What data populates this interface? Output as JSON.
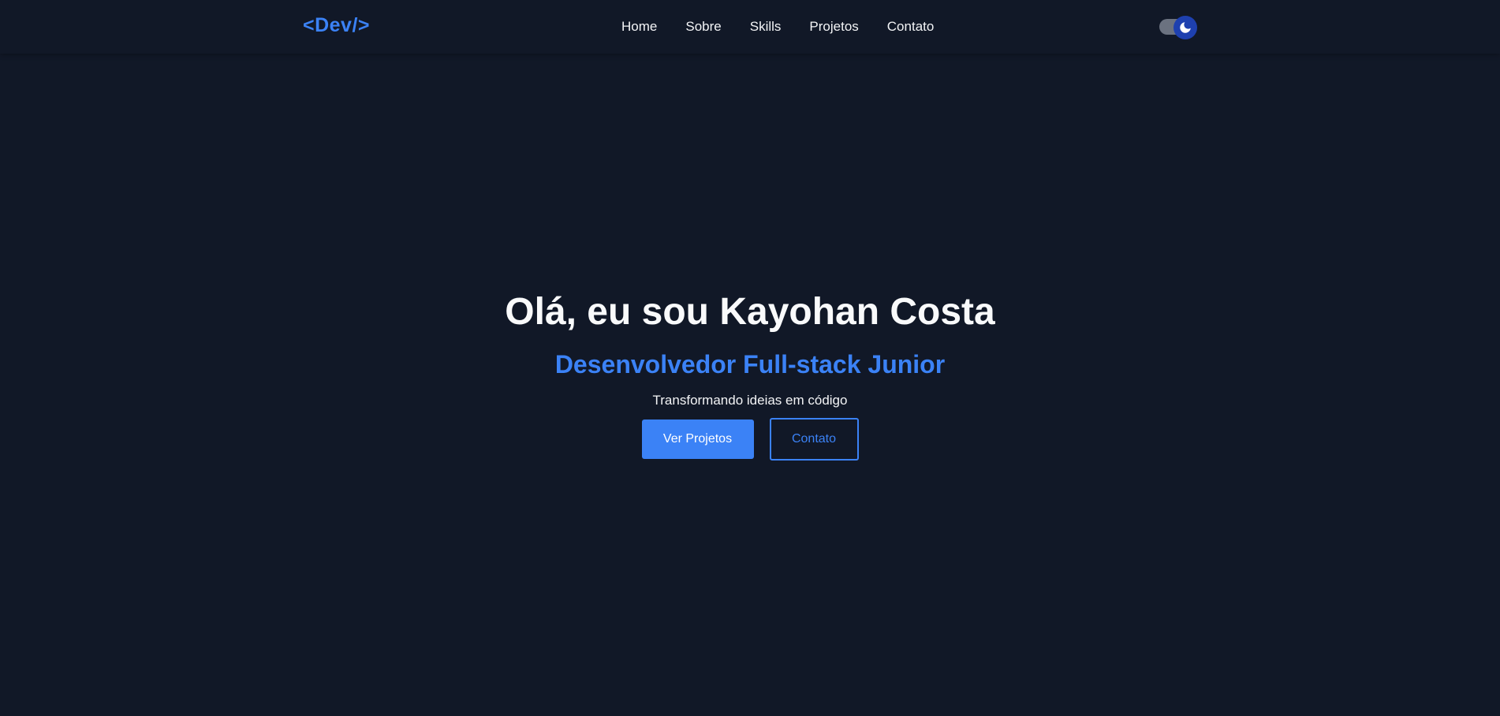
{
  "header": {
    "logo": "<Dev/>",
    "nav": [
      {
        "label": "Home"
      },
      {
        "label": "Sobre"
      },
      {
        "label": "Skills"
      },
      {
        "label": "Projetos"
      },
      {
        "label": "Contato"
      }
    ],
    "theme_toggle": {
      "icon": "moon-icon",
      "state": "dark"
    }
  },
  "hero": {
    "title": "Olá, eu sou Kayohan Costa",
    "subtitle": "Desenvolvedor Full-stack Junior",
    "tagline": "Transformando ideias em código",
    "primary_button": "Ver Projetos",
    "secondary_button": "Contato"
  },
  "colors": {
    "background": "#111827",
    "accent": "#3b82f6",
    "text": "#f3f4f6",
    "toggle_knob": "#1e40af"
  }
}
